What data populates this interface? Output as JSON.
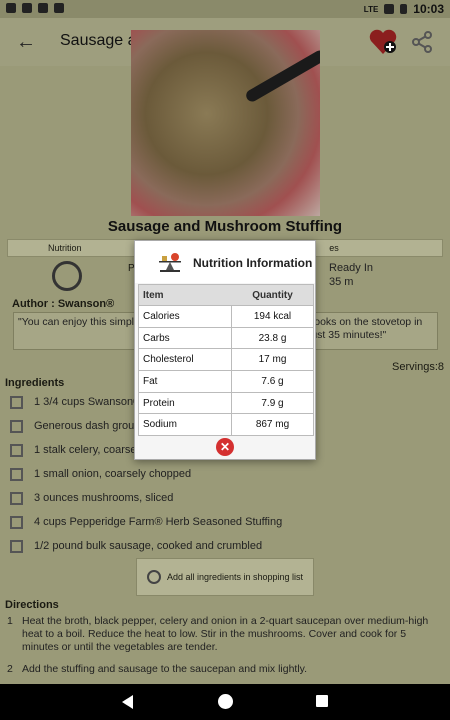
{
  "status_bar": {
    "time": "10:03",
    "network": "LTE"
  },
  "app_bar": {
    "title": "Sausage and Mushroom Stuffing"
  },
  "recipe": {
    "title": "Sausage and Mushroom Stuffing",
    "tab_nutrition": "Nutrition",
    "tab_other": "es",
    "prep_label": "P",
    "ready_label": "Ready In",
    "ready_value": "35 m",
    "author": "Author : Swanson®",
    "description": "\"You can enjoy this simpl",
    "description_tail": "cooks on the stovetop in just 35 minutes!\"",
    "servings": "Servings:8"
  },
  "ingredients": {
    "title": "Ingredients",
    "items": [
      "1 3/4 cups Swanson®",
      "Generous dash groun",
      "1 stalk celery, coarsel",
      "1 small onion, coarsely chopped",
      "3 ounces mushrooms, sliced",
      "4 cups Pepperidge Farm® Herb Seasoned Stuffing",
      "1/2 pound bulk sausage, cooked and crumbled"
    ],
    "add_all_label": "Add all ingredients in shopping list"
  },
  "directions": {
    "title": "Directions",
    "steps": [
      "Heat the broth, black pepper, celery and onion in a 2-quart saucepan over medium-high heat to a boil. Reduce the heat to low. Stir in the mushrooms. Cover and cook for 5 minutes or until the vegetables are tender.",
      "Add the stuffing and sausage to the saucepan and mix lightly."
    ]
  },
  "nutrition_dialog": {
    "title": "Nutrition Information",
    "col_item": "Item",
    "col_quantity": "Quantity",
    "rows": [
      {
        "item": "Calories",
        "quantity": "194 kcal"
      },
      {
        "item": "Carbs",
        "quantity": "23.8 g"
      },
      {
        "item": "Cholesterol",
        "quantity": "17 mg"
      },
      {
        "item": "Fat",
        "quantity": "7.6 g"
      },
      {
        "item": "Protein",
        "quantity": "7.9 g"
      },
      {
        "item": "Sodium",
        "quantity": "867 mg"
      }
    ]
  },
  "colors": {
    "dim_background": "#9a9a78",
    "close_button": "#d43030"
  }
}
